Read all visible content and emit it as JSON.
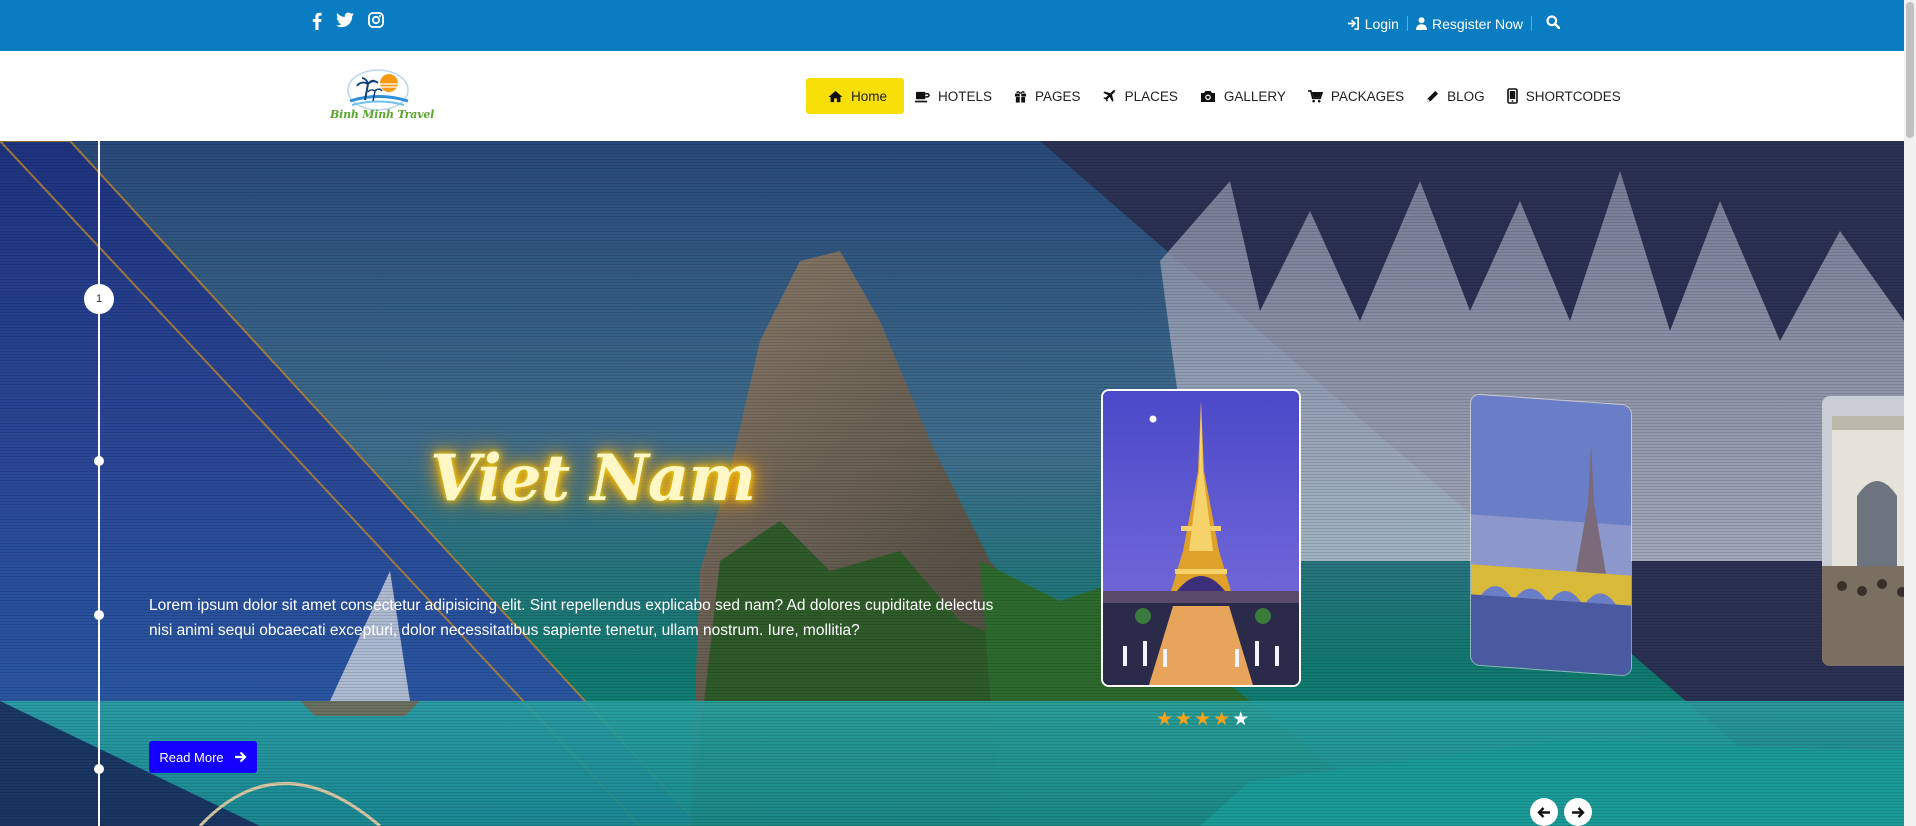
{
  "topbar": {
    "social_icons": [
      "facebook-icon",
      "twitter-icon",
      "instagram-icon"
    ],
    "login_label": "Login",
    "register_label": "Resgister Now",
    "bg_color": "#0a7cc1"
  },
  "header": {
    "logo_text": "Binh Minh Travel",
    "nav": [
      {
        "label": "Home",
        "icon": "home-icon",
        "active": true
      },
      {
        "label": "HOTELS",
        "icon": "coffee-cup-icon"
      },
      {
        "label": "PAGES",
        "icon": "gift-icon"
      },
      {
        "label": "PLACES",
        "icon": "plane-icon"
      },
      {
        "label": "GALLERY",
        "icon": "camera-icon"
      },
      {
        "label": "PACKAGES",
        "icon": "cart-icon"
      },
      {
        "label": "BLOG",
        "icon": "pencil-icon"
      },
      {
        "label": "SHORTCODES",
        "icon": "mobile-icon"
      }
    ],
    "active_color": "#f8df08"
  },
  "hero": {
    "timeline_number": "1",
    "title": "Viet Nam",
    "text": "Lorem ipsum dolor sit amet consectetur adipisicing elit. Sint repellendus explicabo sed nam? Ad dolores cupiditate delectus nisi animi sequi obcaecati excepturi, dolor necessitatibus sapiente tenetur, ullam nostrum. Iure, mollitia?",
    "button_label": "Read More",
    "button_color": "#1400ff",
    "rating": 4,
    "rating_max": 5
  }
}
